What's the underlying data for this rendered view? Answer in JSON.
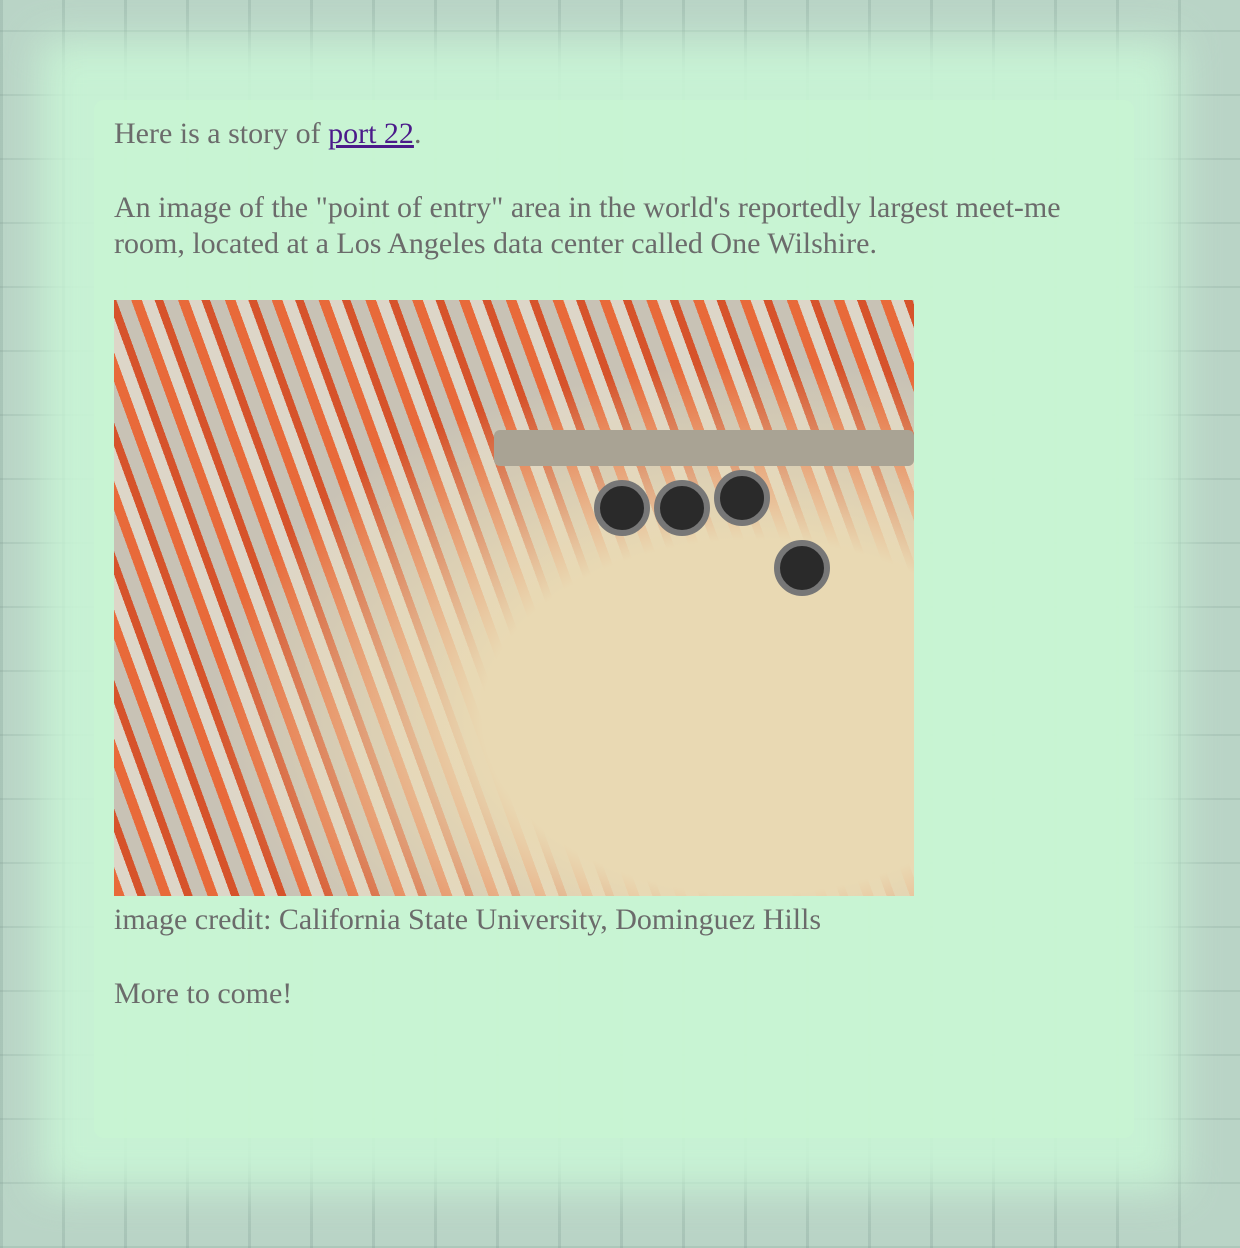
{
  "intro": {
    "text": "Here is a story of ",
    "link": "port 22",
    "after": "."
  },
  "description": "An image of the \"point of entry\" area in the world's reportedly largest meet-me room, located at a Los Angeles data center called One Wilshire.",
  "image": {
    "alt": "Cables entering point of entry area"
  },
  "caption": "image credit: California State University, Dominguez Hills",
  "footer": "More to come!"
}
